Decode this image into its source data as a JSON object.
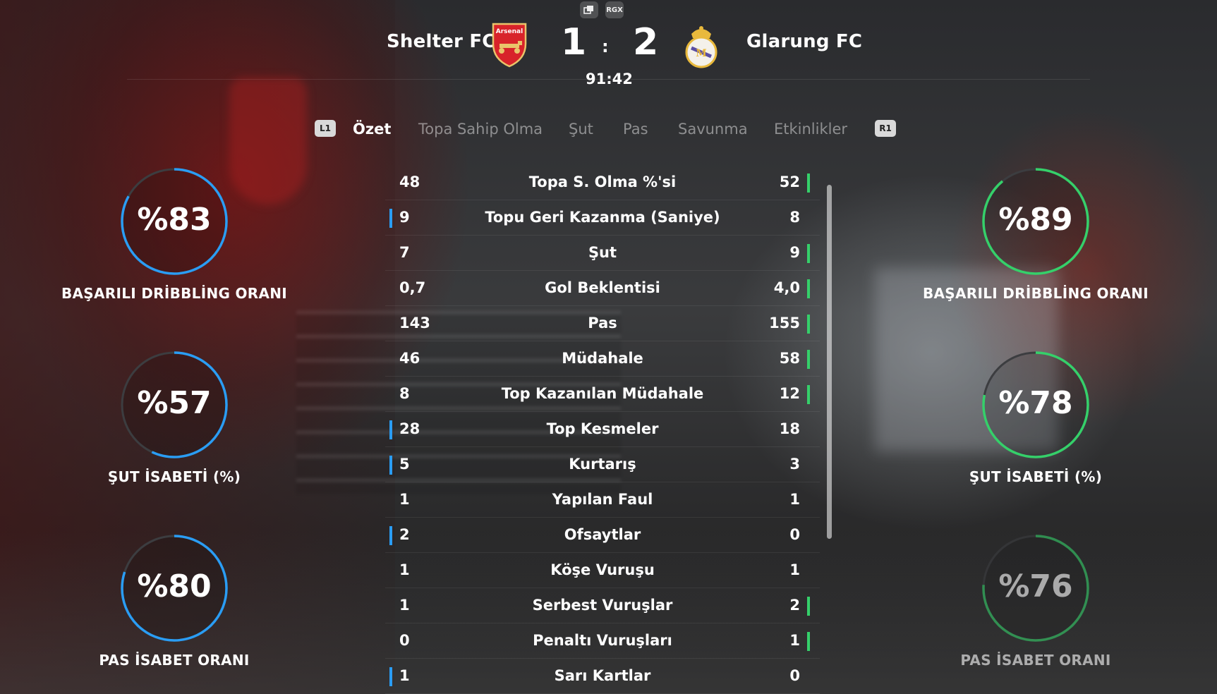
{
  "header": {
    "top_icons": [
      "",
      "RGX"
    ],
    "home_team": "Shelter FC",
    "away_team": "Glarung FC",
    "home_badge_text": "Arsenal",
    "home_score": "1",
    "score_separator": ":",
    "away_score": "2",
    "clock": "91:42"
  },
  "tabs": {
    "left_hint": "L1",
    "right_hint": "R1",
    "items": [
      "Özet",
      "Topa Sahip Olma",
      "Şut",
      "Pas",
      "Savunma",
      "Etkinlikler"
    ]
  },
  "colors": {
    "home_ring": "#2a9df4",
    "away_ring": "#35d06a",
    "ring_track": "#3c3d40"
  },
  "home_rings": [
    {
      "value": "%83",
      "fraction": 0.83,
      "label": "BAŞARILI DRİBBLİNG ORANI"
    },
    {
      "value": "%57",
      "fraction": 0.57,
      "label": "ŞUT İSABETİ (%)"
    },
    {
      "value": "%80",
      "fraction": 0.8,
      "label": "PAS İSABET ORANI"
    }
  ],
  "away_rings": [
    {
      "value": "%89",
      "fraction": 0.89,
      "label": "BAŞARILI DRİBBLİNG ORANI"
    },
    {
      "value": "%78",
      "fraction": 0.78,
      "label": "ŞUT İSABETİ (%)"
    },
    {
      "value": "%76",
      "fraction": 0.76,
      "label": "PAS İSABET ORANI"
    }
  ],
  "stats": [
    {
      "home": "48",
      "label": "Topa S. Olma %'si",
      "away": "52",
      "leader": "away"
    },
    {
      "home": "9",
      "label": "Topu Geri Kazanma (Saniye)",
      "away": "8",
      "leader": "home"
    },
    {
      "home": "7",
      "label": "Şut",
      "away": "9",
      "leader": "away"
    },
    {
      "home": "0,7",
      "label": "Gol Beklentisi",
      "away": "4,0",
      "leader": "away"
    },
    {
      "home": "143",
      "label": "Pas",
      "away": "155",
      "leader": "away"
    },
    {
      "home": "46",
      "label": "Müdahale",
      "away": "58",
      "leader": "away"
    },
    {
      "home": "8",
      "label": "Top Kazanılan Müdahale",
      "away": "12",
      "leader": "away"
    },
    {
      "home": "28",
      "label": "Top Kesmeler",
      "away": "18",
      "leader": "home"
    },
    {
      "home": "5",
      "label": "Kurtarış",
      "away": "3",
      "leader": "home"
    },
    {
      "home": "1",
      "label": "Yapılan Faul",
      "away": "1",
      "leader": "none"
    },
    {
      "home": "2",
      "label": "Ofsaytlar",
      "away": "0",
      "leader": "home"
    },
    {
      "home": "1",
      "label": "Köşe Vuruşu",
      "away": "1",
      "leader": "none"
    },
    {
      "home": "1",
      "label": "Serbest Vuruşlar",
      "away": "2",
      "leader": "away"
    },
    {
      "home": "0",
      "label": "Penaltı Vuruşları",
      "away": "1",
      "leader": "away"
    },
    {
      "home": "1",
      "label": "Sarı Kartlar",
      "away": "0",
      "leader": "home"
    }
  ]
}
